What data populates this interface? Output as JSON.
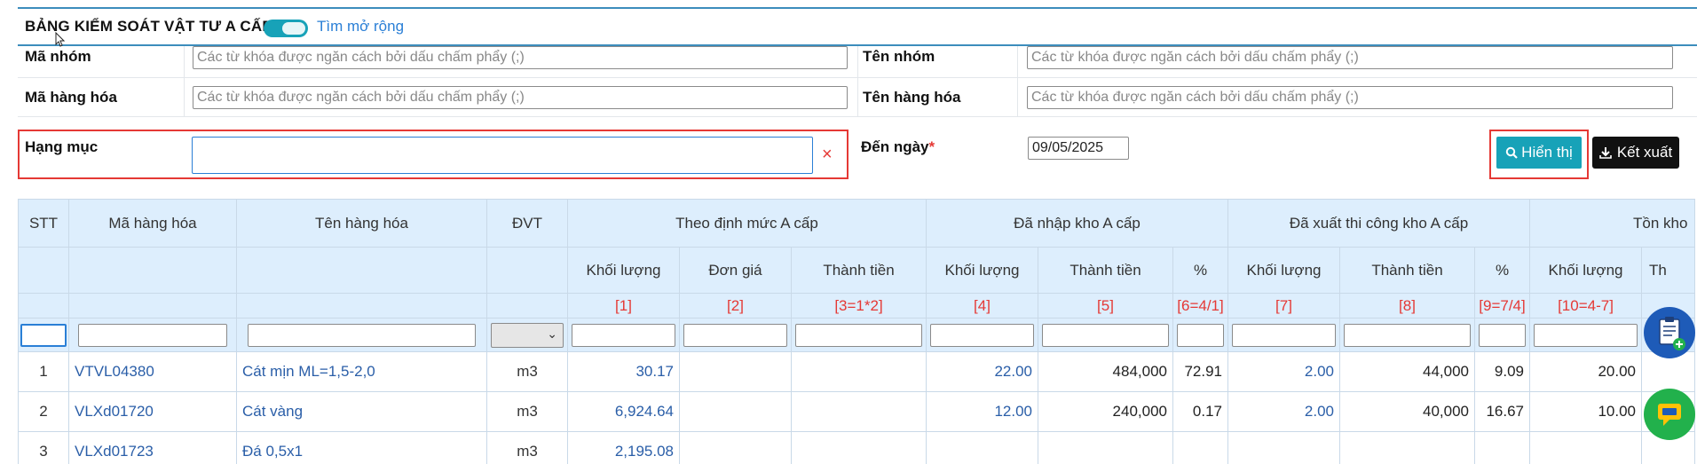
{
  "header": {
    "title": "BẢNG KIỂM SOÁT VẬT TƯ A CẤP",
    "expand_link": "Tìm mở rộng"
  },
  "filters": {
    "group_code": {
      "label": "Mã nhóm",
      "placeholder": "Các từ khóa được ngăn cách bởi dấu chấm phẩy (;)"
    },
    "group_name": {
      "label": "Tên nhóm",
      "placeholder": "Các từ khóa được ngăn cách bởi dấu chấm phẩy (;)"
    },
    "item_code": {
      "label": "Mã hàng hóa",
      "placeholder": "Các từ khóa được ngăn cách bởi dấu chấm phẩy (;)"
    },
    "item_name": {
      "label": "Tên hàng hóa",
      "placeholder": "Các từ khóa được ngăn cách bởi dấu chấm phẩy (;)"
    },
    "category": {
      "label": "Hạng mục",
      "value": "",
      "clear": "×"
    },
    "to_date": {
      "label": "Đến ngày",
      "required_mark": "*",
      "value": "09/05/2025"
    }
  },
  "buttons": {
    "show": "Hiển thị",
    "export": "Kết xuất"
  },
  "table": {
    "headers": {
      "stt": "STT",
      "code": "Mã hàng hóa",
      "name": "Tên hàng hóa",
      "unit": "ĐVT",
      "group_norm": "Theo định mức A cấp",
      "group_import": "Đã nhập kho A cấp",
      "group_export": "Đã xuất thi công kho A cấp",
      "group_stock": "Tồn kho",
      "qty": "Khối lượng",
      "price": "Đơn giá",
      "amount": "Thành tiền",
      "pct": "%",
      "amount_cut": "Th"
    },
    "formulas": [
      "[1]",
      "[2]",
      "[3=1*2]",
      "[4]",
      "[5]",
      "[6=4/1]",
      "[7]",
      "[8]",
      "[9=7/4]",
      "[10=4-7]"
    ],
    "rows": [
      {
        "stt": "1",
        "code": "VTVL04380",
        "name": "Cát mịn ML=1,5-2,0",
        "unit": "m3",
        "norm_qty": "30.17",
        "norm_price": "",
        "norm_amount": "",
        "imp_qty": "22.00",
        "imp_amount": "484,000",
        "imp_pct": "72.91",
        "exp_qty": "2.00",
        "exp_amount": "44,000",
        "exp_pct": "9.09",
        "stock_qty": "20.00"
      },
      {
        "stt": "2",
        "code": "VLXd01720",
        "name": "Cát vàng",
        "unit": "m3",
        "norm_qty": "6,924.64",
        "norm_price": "",
        "norm_amount": "",
        "imp_qty": "12.00",
        "imp_amount": "240,000",
        "imp_pct": "0.17",
        "exp_qty": "2.00",
        "exp_amount": "40,000",
        "exp_pct": "16.67",
        "stock_qty": "10.00"
      },
      {
        "stt": "3",
        "code": "VLXd01723",
        "name": "Đá 0,5x1",
        "unit": "m3",
        "norm_qty": "2,195.08",
        "norm_price": "",
        "norm_amount": "",
        "imp_qty": "",
        "imp_amount": "",
        "imp_pct": "",
        "exp_qty": "",
        "exp_amount": "",
        "exp_pct": "",
        "stock_qty": ""
      }
    ]
  },
  "colors": {
    "accent": "#17a2b8",
    "link": "#2a5ea8",
    "highlight": "#e53935",
    "header_bg": "#ddeefd"
  }
}
